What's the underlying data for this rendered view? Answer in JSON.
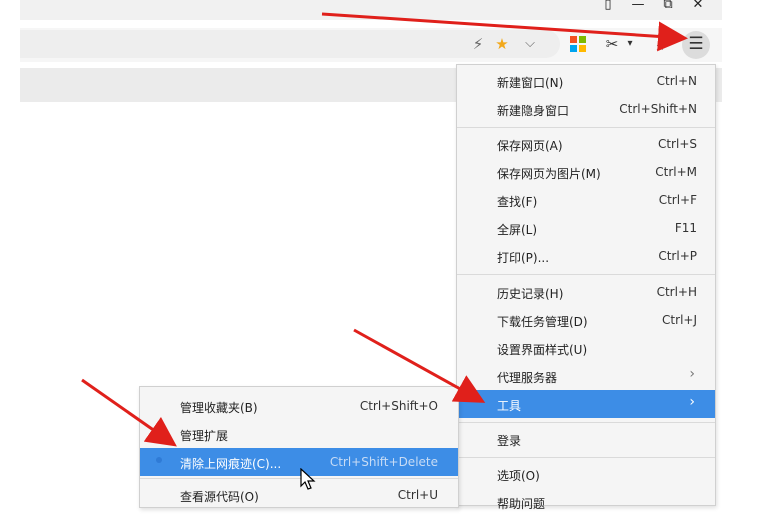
{
  "window": {
    "buttons": [
      "▯",
      "—",
      "⧉",
      "✕"
    ]
  },
  "toolbar": {
    "icons": [
      "lightning-icon",
      "star-icon",
      "chevron-down-icon",
      "microsoft-grid-icon",
      "scissors-icon",
      "download-icon",
      "menu-icon"
    ],
    "glyphs": {
      "lightning": "⚡",
      "star": "★",
      "chevron": "⌵",
      "scissors": "✂",
      "dropdown": "▾",
      "download": "⤓",
      "menu": "☰"
    },
    "grid_colors": [
      "#f25022",
      "#7fba00",
      "#00a4ef",
      "#ffb900"
    ]
  },
  "menu": {
    "items": [
      {
        "label": "新建窗口(N)",
        "shortcut": "Ctrl+N"
      },
      {
        "label": "新建隐身窗口",
        "shortcut": "Ctrl+Shift+N"
      },
      {
        "label": "保存网页(A)",
        "shortcut": "Ctrl+S"
      },
      {
        "label": "保存网页为图片(M)",
        "shortcut": "Ctrl+M"
      },
      {
        "label": "查找(F)",
        "shortcut": "Ctrl+F"
      },
      {
        "label": "全屏(L)",
        "shortcut": "F11"
      },
      {
        "label": "打印(P)...",
        "shortcut": "Ctrl+P"
      },
      {
        "label": "历史记录(H)",
        "shortcut": "Ctrl+H"
      },
      {
        "label": "下载任务管理(D)",
        "shortcut": "Ctrl+J"
      },
      {
        "label": "设置界面样式(U)",
        "shortcut": ""
      },
      {
        "label": "代理服务器",
        "shortcut": "",
        "arrow": "›"
      },
      {
        "label": "工具",
        "shortcut": "",
        "arrow": "›",
        "highlighted": true
      },
      {
        "label": "登录",
        "shortcut": ""
      },
      {
        "label": "选项(O)",
        "shortcut": ""
      },
      {
        "label": "帮助问题",
        "shortcut": ""
      }
    ]
  },
  "submenu": {
    "items": [
      {
        "label": "管理收藏夹(B)",
        "shortcut": "Ctrl+Shift+O"
      },
      {
        "label": "管理扩展",
        "shortcut": ""
      },
      {
        "label": "清除上网痕迹(C)...",
        "shortcut": "Ctrl+Shift+Delete",
        "highlighted": true
      },
      {
        "label": "查看源代码(O)",
        "shortcut": "Ctrl+U"
      }
    ]
  },
  "accent_color": "#3d8de6",
  "annotation_color": "#e0201b"
}
